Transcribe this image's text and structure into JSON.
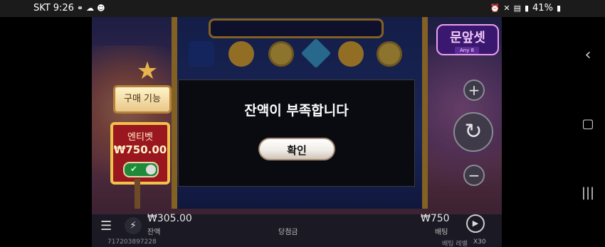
{
  "status_bar": {
    "carrier": "SKT",
    "time": "9:26",
    "battery": "41%"
  },
  "game": {
    "logo_text": "문앞셋",
    "logo_sub": "Any 8",
    "buy_feature_label": "구매 기능",
    "ante_bet_label": "엔티벳",
    "ante_bet_price": "₩750.00",
    "balance_value": "₩305.00",
    "balance_label": "잔액",
    "win_label": "당첨금",
    "bet_value": "₩750",
    "bet_label": "배팅",
    "game_id": "717203897228",
    "multiplier_label": "배팅 레벨",
    "multiplier_value": "X30"
  },
  "dialog": {
    "message": "잔액이 부족합니다",
    "confirm_label": "확인"
  },
  "colors": {
    "modal_bg": "#0a0a0c",
    "ante_sign": "#9a1720",
    "toggle_on": "#1f8a3a",
    "frame_gold": "#c99535"
  }
}
